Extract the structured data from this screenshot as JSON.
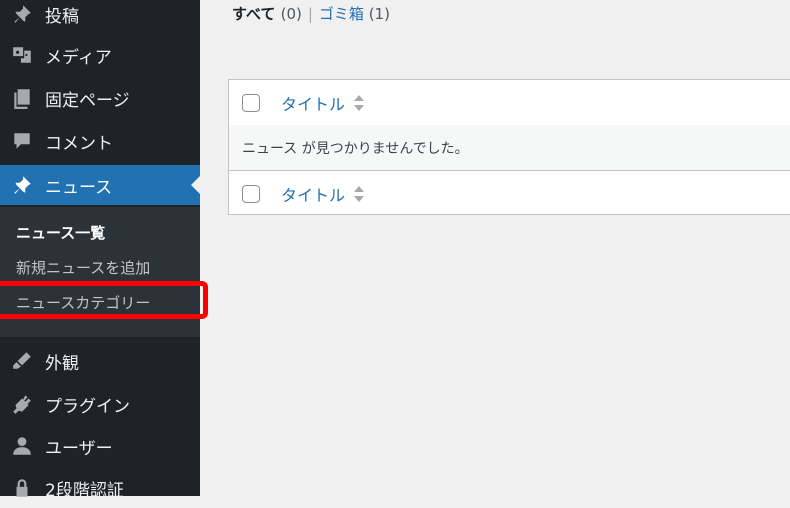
{
  "sidebar": {
    "items": [
      {
        "label": "投稿",
        "icon": "pin-icon"
      },
      {
        "label": "メディア",
        "icon": "media-icon"
      },
      {
        "label": "固定ページ",
        "icon": "page-icon"
      },
      {
        "label": "コメント",
        "icon": "comment-icon"
      },
      {
        "label": "ニュース",
        "icon": "pin-icon",
        "active": true
      },
      {
        "label": "外観",
        "icon": "brush-icon"
      },
      {
        "label": "プラグイン",
        "icon": "plugin-icon"
      },
      {
        "label": "ユーザー",
        "icon": "user-icon"
      },
      {
        "label": "2段階認証",
        "icon": "lock-icon"
      }
    ],
    "submenu": [
      {
        "label": "ニュース一覧",
        "current": true
      },
      {
        "label": "新規ニュースを追加"
      },
      {
        "label": "ニュースカテゴリー"
      }
    ],
    "colors": {
      "background": "#1d2327",
      "active": "#2271b1",
      "highlight": "#ff0000"
    }
  },
  "filters": {
    "all_label": "すべて",
    "all_count": "(0)",
    "separator": "|",
    "trash_label": "ゴミ箱",
    "trash_count": "(1)"
  },
  "table": {
    "column_title": "タイトル",
    "empty_message": "ニュース が見つかりませんでした。"
  }
}
